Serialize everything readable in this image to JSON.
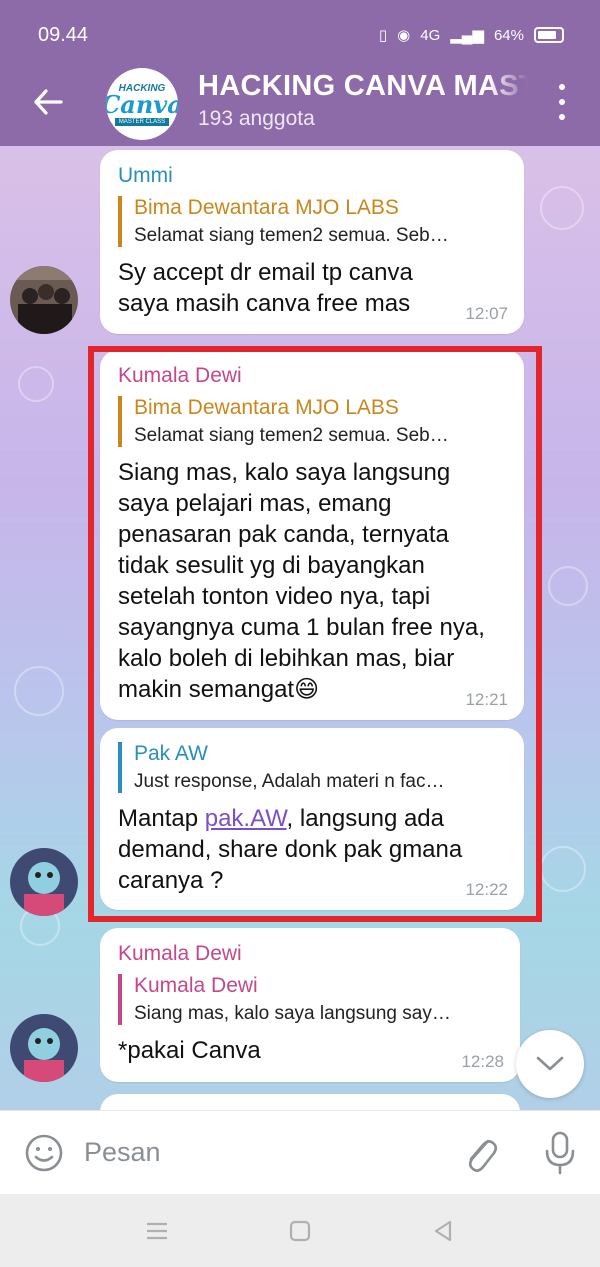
{
  "status_bar": {
    "time": "09.44",
    "battery": "64%",
    "network": "4G"
  },
  "header": {
    "title": "HACKING CANVA MASTER CLASS",
    "subtitle": "193 anggota",
    "avatar_line1": "HACKING",
    "avatar_line2": "Canva",
    "avatar_line3": "MASTER CLASS"
  },
  "messages": [
    {
      "sender": "Ummi",
      "sender_color": "#2a8fbd",
      "reply_name": "Bima Dewantara MJO LABS",
      "reply_color": "#c9871c",
      "reply_text": "Selamat siang temen2 semua. Seb…",
      "text": "Sy accept dr email tp canva saya masih canva free mas",
      "time": "12:07"
    },
    {
      "sender": "Kumala Dewi",
      "sender_color": "#c4478c",
      "reply_name": "Bima Dewantara MJO LABS",
      "reply_color": "#c9871c",
      "reply_text": "Selamat siang temen2 semua. Seb…",
      "text": "Siang mas, kalo saya langsung saya pelajari mas, emang penasaran pak canda, ternyata tidak sesulit yg di bayangkan setelah tonton video nya, tapi sayangnya cuma 1 bulan free nya, kalo boleh di lebihkan mas, biar makin semangat😄",
      "time": "12:21"
    },
    {
      "sender": "",
      "reply_name": "Pak AW",
      "reply_color": "#2a8fbd",
      "reply_text": "Just response,  Adalah materi n fac…",
      "text_before": "Mantap ",
      "link": "pak.AW",
      "text_after": ", langsung ada demand, share donk pak gmana caranya ?",
      "time": "12:22"
    },
    {
      "sender": "Kumala Dewi",
      "sender_color": "#c4478c",
      "reply_name": "Kumala Dewi",
      "reply_color": "#c4478c",
      "reply_text": "Siang mas, kalo saya langsung say…",
      "text": "*pakai Canva",
      "time": "12:28"
    }
  ],
  "input": {
    "placeholder": "Pesan"
  },
  "icons": {
    "back": "arrow-left-icon",
    "menu": "more-vertical-icon",
    "emoji": "smiley-icon",
    "attach": "paperclip-icon",
    "mic": "microphone-icon",
    "scroll": "chevron-down-icon"
  },
  "colors": {
    "header": "#8d6aa8",
    "highlight": "#e3262d",
    "link": "#7a4fc9"
  }
}
